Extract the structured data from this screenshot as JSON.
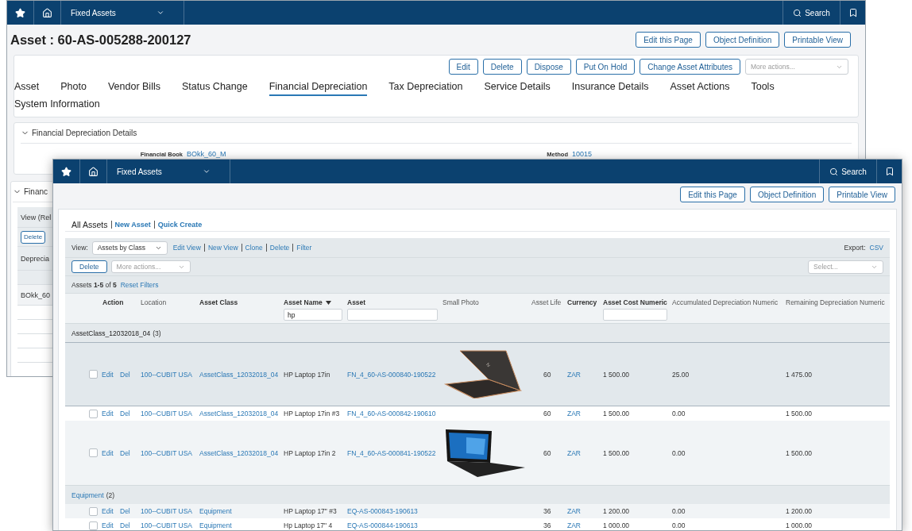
{
  "back_window": {
    "navbar": {
      "app": "Fixed Assets",
      "search": "Search"
    },
    "title": "Asset : 60-AS-005288-200127",
    "page_buttons": [
      "Edit this Page",
      "Object Definition",
      "Printable View"
    ],
    "action_buttons": [
      "Edit",
      "Delete",
      "Dispose",
      "Put On Hold",
      "Change Asset Attributes"
    ],
    "more_actions": {
      "placeholder": "More actions..."
    },
    "tabs": [
      {
        "label": "Asset",
        "selected": false
      },
      {
        "label": "Photo",
        "selected": false
      },
      {
        "label": "Vendor Bills",
        "selected": false
      },
      {
        "label": "Status Change",
        "selected": false
      },
      {
        "label": "Financial Depreciation",
        "selected": true
      },
      {
        "label": "Tax Depreciation",
        "selected": false
      },
      {
        "label": "Service Details",
        "selected": false
      },
      {
        "label": "Insurance Details",
        "selected": false
      },
      {
        "label": "Asset Actions",
        "selected": false
      },
      {
        "label": "Tools",
        "selected": false
      },
      {
        "label": "System Information",
        "selected": false
      }
    ],
    "details_section": {
      "title": "Financial Depreciation Details",
      "expanded": true,
      "fields": [
        {
          "label": "Financial Book",
          "value": "BOkk_60_M"
        },
        {
          "label": "Method",
          "value": "10015"
        }
      ]
    },
    "second_section": {
      "title": "Financ",
      "expanded": true,
      "view_label": "View (Rel",
      "delete_button": "Delete",
      "column_1": "Deprecia",
      "row_1": "BOkk_60"
    }
  },
  "front_window": {
    "navbar": {
      "app": "Fixed Assets",
      "search": "Search"
    },
    "page_buttons": [
      "Edit this Page",
      "Object Definition",
      "Printable View"
    ],
    "breadcrumb": {
      "current": "All Assets",
      "links": [
        "New Asset",
        "Quick Create"
      ]
    },
    "view": {
      "label": "View:",
      "value": "Assets by Class",
      "links": [
        "Edit View",
        "New View",
        "Clone",
        "Delete",
        "Filter"
      ],
      "export_label": "Export:",
      "export_link": "CSV"
    },
    "actions": {
      "delete": "Delete",
      "more_actions": {
        "placeholder": "More actions..."
      },
      "select": {
        "placeholder": "Select..."
      }
    },
    "summary": {
      "text": "Assets **1-5** of **5**",
      "reset": "Reset Filters"
    },
    "columns": [
      {
        "label": "Action",
        "bold": true
      },
      {
        "label": "Location",
        "bold": false
      },
      {
        "label": "Asset Class",
        "bold": true
      },
      {
        "label": "Asset Name",
        "bold": true,
        "sorted": true,
        "filter_field": true,
        "filter_value": "hp"
      },
      {
        "label": "Asset",
        "bold": true,
        "filter_field": true
      },
      {
        "label": "Small Photo",
        "bold": false
      },
      {
        "label": "Asset Life",
        "bold": false
      },
      {
        "label": "Currency",
        "bold": true
      },
      {
        "label": "Asset Cost Numeric",
        "bold": true,
        "filter_field": true
      },
      {
        "label": "Accumulated Depreciation Numeric",
        "bold": false
      },
      {
        "label": "Remaining Depreciation Numeric",
        "bold": false
      }
    ],
    "groups": [
      {
        "name": "AssetClass_12032018_04",
        "count": "(3)",
        "link": false,
        "rows": [
          {
            "checked": false,
            "highlighted": true,
            "edit": "Edit",
            "del": "Del",
            "location": "100--CUBIT USA",
            "asset_class": "AssetClass_12032018_04",
            "asset_name": "HP Laptop 17in",
            "asset": "FN_4_60-AS-000840-190522",
            "kind": "backview",
            "asset_life": "60",
            "currency": "ZAR",
            "cost": "1 500.00",
            "accumulated": "25.00",
            "remaining": "1 475.00"
          },
          {
            "checked": false,
            "highlighted": false,
            "edit": "Edit",
            "del": "Del",
            "location": "100--CUBIT USA",
            "asset_class": "AssetClass_12032018_04",
            "asset_name": "HP Laptop 17in #3",
            "asset": "FN_4_60-AS-000842-190610",
            "kind": "plain",
            "asset_life": "60",
            "currency": "ZAR",
            "cost": "1 500.00",
            "accumulated": "0.00",
            "remaining": "1 500.00"
          },
          {
            "checked": false,
            "highlighted": false,
            "edit": "Edit",
            "del": "Del",
            "location": "100--CUBIT USA",
            "asset_class": "AssetClass_12032018_04",
            "asset_name": "HP Laptop 17in 2",
            "asset": "FN_4_60-AS-000841-190522",
            "kind": "frontview",
            "asset_life": "60",
            "currency": "ZAR",
            "cost": "1 500.00",
            "accumulated": "0.00",
            "remaining": "1 500.00"
          }
        ]
      },
      {
        "name": "Equipment",
        "count": "(2)",
        "link": true,
        "rows": [
          {
            "checked": false,
            "highlighted": false,
            "edit": "Edit",
            "del": "Del",
            "location": "100--CUBIT USA",
            "asset_class": "Equipment",
            "asset_name": "HP Laptop 17\" #3",
            "asset": "EQ-AS-000843-190613",
            "kind": "plain",
            "asset_life": "36",
            "currency": "ZAR",
            "cost": "1 200.00",
            "accumulated": "0.00",
            "remaining": "1 200.00"
          },
          {
            "checked": false,
            "highlighted": false,
            "edit": "Edit",
            "del": "Del",
            "location": "100--CUBIT USA",
            "asset_class": "Equipment",
            "asset_name": "Hp Laptop 17\" 4",
            "asset": "EQ-AS-000844-190613",
            "kind": "plain",
            "asset_life": "36",
            "currency": "ZAR",
            "cost": "1 000.00",
            "accumulated": "0.00",
            "remaining": "1 000.00"
          }
        ]
      }
    ]
  }
}
